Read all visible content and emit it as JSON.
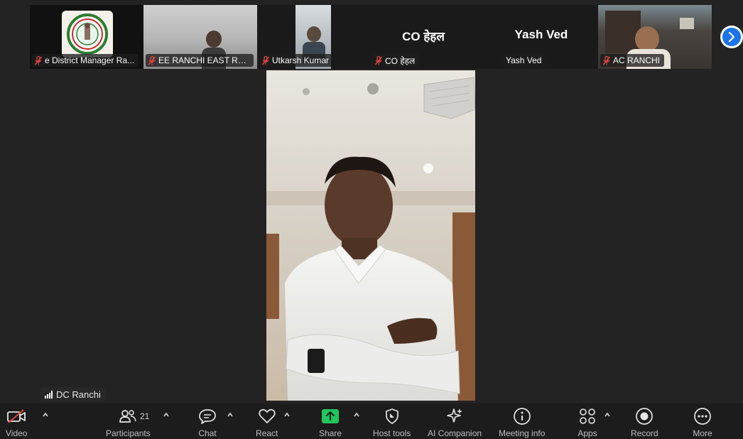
{
  "filmstrip": {
    "tiles": [
      {
        "name": "e District Manager Ra...",
        "muted": true
      },
      {
        "name": "EE RANCHI EAST RAN...",
        "muted": true
      },
      {
        "name": "Utkarsh Kumar",
        "muted": true
      },
      {
        "name": "CO हेहल",
        "display_name": "CO हेहल",
        "muted": true
      },
      {
        "name": "Yash Ved",
        "display_name": "Yash Ved",
        "muted": false
      },
      {
        "name": "AC RANCHI",
        "muted": true
      }
    ]
  },
  "speaker": {
    "name": "DC Ranchi"
  },
  "toolbar": {
    "video_label": "Video",
    "participants_label": "Participants",
    "participants_count": "21",
    "chat_label": "Chat",
    "react_label": "React",
    "share_label": "Share",
    "host_tools_label": "Host tools",
    "ai_companion_label": "AI Companion",
    "meeting_info_label": "Meeting info",
    "apps_label": "Apps",
    "record_label": "Record",
    "more_label": "More"
  },
  "colors": {
    "background": "#232323",
    "toolbar": "#1c1c1c",
    "muted_red": "#e0443e",
    "share_green": "#22c55e",
    "arrow_blue": "#1a73e8"
  }
}
